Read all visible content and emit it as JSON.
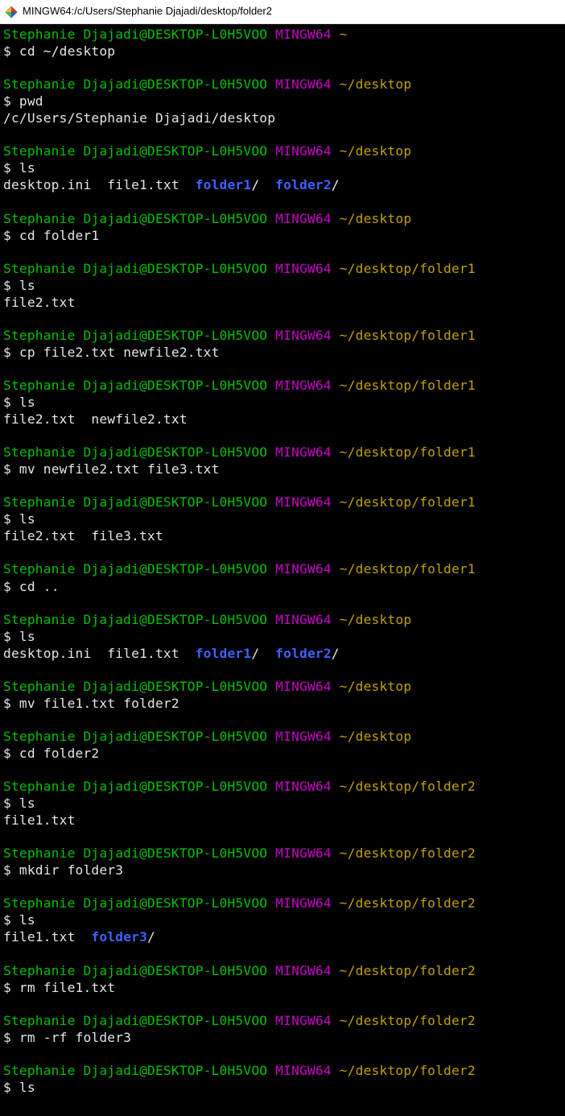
{
  "window": {
    "title": "MINGW64:/c/Users/Stephanie Djajadi/desktop/folder2"
  },
  "prompt": {
    "userhost": "Stephanie Djajadi@DESKTOP-L0H5VOO",
    "env": "MINGW64",
    "dollar": "$"
  },
  "blocks": [
    {
      "path": "~",
      "cmd": "cd ~/desktop",
      "out": []
    },
    {
      "path": "~/desktop",
      "cmd": "pwd",
      "out": [
        [
          {
            "t": "plain",
            "v": "/c/Users/Stephanie Djajadi/desktop"
          }
        ]
      ]
    },
    {
      "path": "~/desktop",
      "cmd": "ls",
      "out": [
        [
          {
            "t": "plain",
            "v": "desktop.ini  file1.txt  "
          },
          {
            "t": "dir",
            "v": "folder1"
          },
          {
            "t": "plain",
            "v": "/  "
          },
          {
            "t": "dir",
            "v": "folder2"
          },
          {
            "t": "plain",
            "v": "/"
          }
        ]
      ]
    },
    {
      "path": "~/desktop",
      "cmd": "cd folder1",
      "out": []
    },
    {
      "path": "~/desktop/folder1",
      "cmd": "ls",
      "out": [
        [
          {
            "t": "plain",
            "v": "file2.txt"
          }
        ]
      ]
    },
    {
      "path": "~/desktop/folder1",
      "cmd": "cp file2.txt newfile2.txt",
      "out": []
    },
    {
      "path": "~/desktop/folder1",
      "cmd": "ls",
      "out": [
        [
          {
            "t": "plain",
            "v": "file2.txt  newfile2.txt"
          }
        ]
      ]
    },
    {
      "path": "~/desktop/folder1",
      "cmd": "mv newfile2.txt file3.txt",
      "out": []
    },
    {
      "path": "~/desktop/folder1",
      "cmd": "ls",
      "out": [
        [
          {
            "t": "plain",
            "v": "file2.txt  file3.txt"
          }
        ]
      ]
    },
    {
      "path": "~/desktop/folder1",
      "cmd": "cd ..",
      "out": []
    },
    {
      "path": "~/desktop",
      "cmd": "ls",
      "out": [
        [
          {
            "t": "plain",
            "v": "desktop.ini  file1.txt  "
          },
          {
            "t": "dir",
            "v": "folder1"
          },
          {
            "t": "plain",
            "v": "/  "
          },
          {
            "t": "dir",
            "v": "folder2"
          },
          {
            "t": "plain",
            "v": "/"
          }
        ]
      ]
    },
    {
      "path": "~/desktop",
      "cmd": "mv file1.txt folder2",
      "out": []
    },
    {
      "path": "~/desktop",
      "cmd": "cd folder2",
      "out": []
    },
    {
      "path": "~/desktop/folder2",
      "cmd": "ls",
      "out": [
        [
          {
            "t": "plain",
            "v": "file1.txt"
          }
        ]
      ]
    },
    {
      "path": "~/desktop/folder2",
      "cmd": "mkdir folder3",
      "out": []
    },
    {
      "path": "~/desktop/folder2",
      "cmd": "ls",
      "out": [
        [
          {
            "t": "plain",
            "v": "file1.txt  "
          },
          {
            "t": "dir",
            "v": "folder3"
          },
          {
            "t": "plain",
            "v": "/"
          }
        ]
      ]
    },
    {
      "path": "~/desktop/folder2",
      "cmd": "rm file1.txt",
      "out": []
    },
    {
      "path": "~/desktop/folder2",
      "cmd": "rm -rf folder3",
      "out": []
    },
    {
      "path": "~/desktop/folder2",
      "cmd": "ls",
      "out": []
    }
  ]
}
